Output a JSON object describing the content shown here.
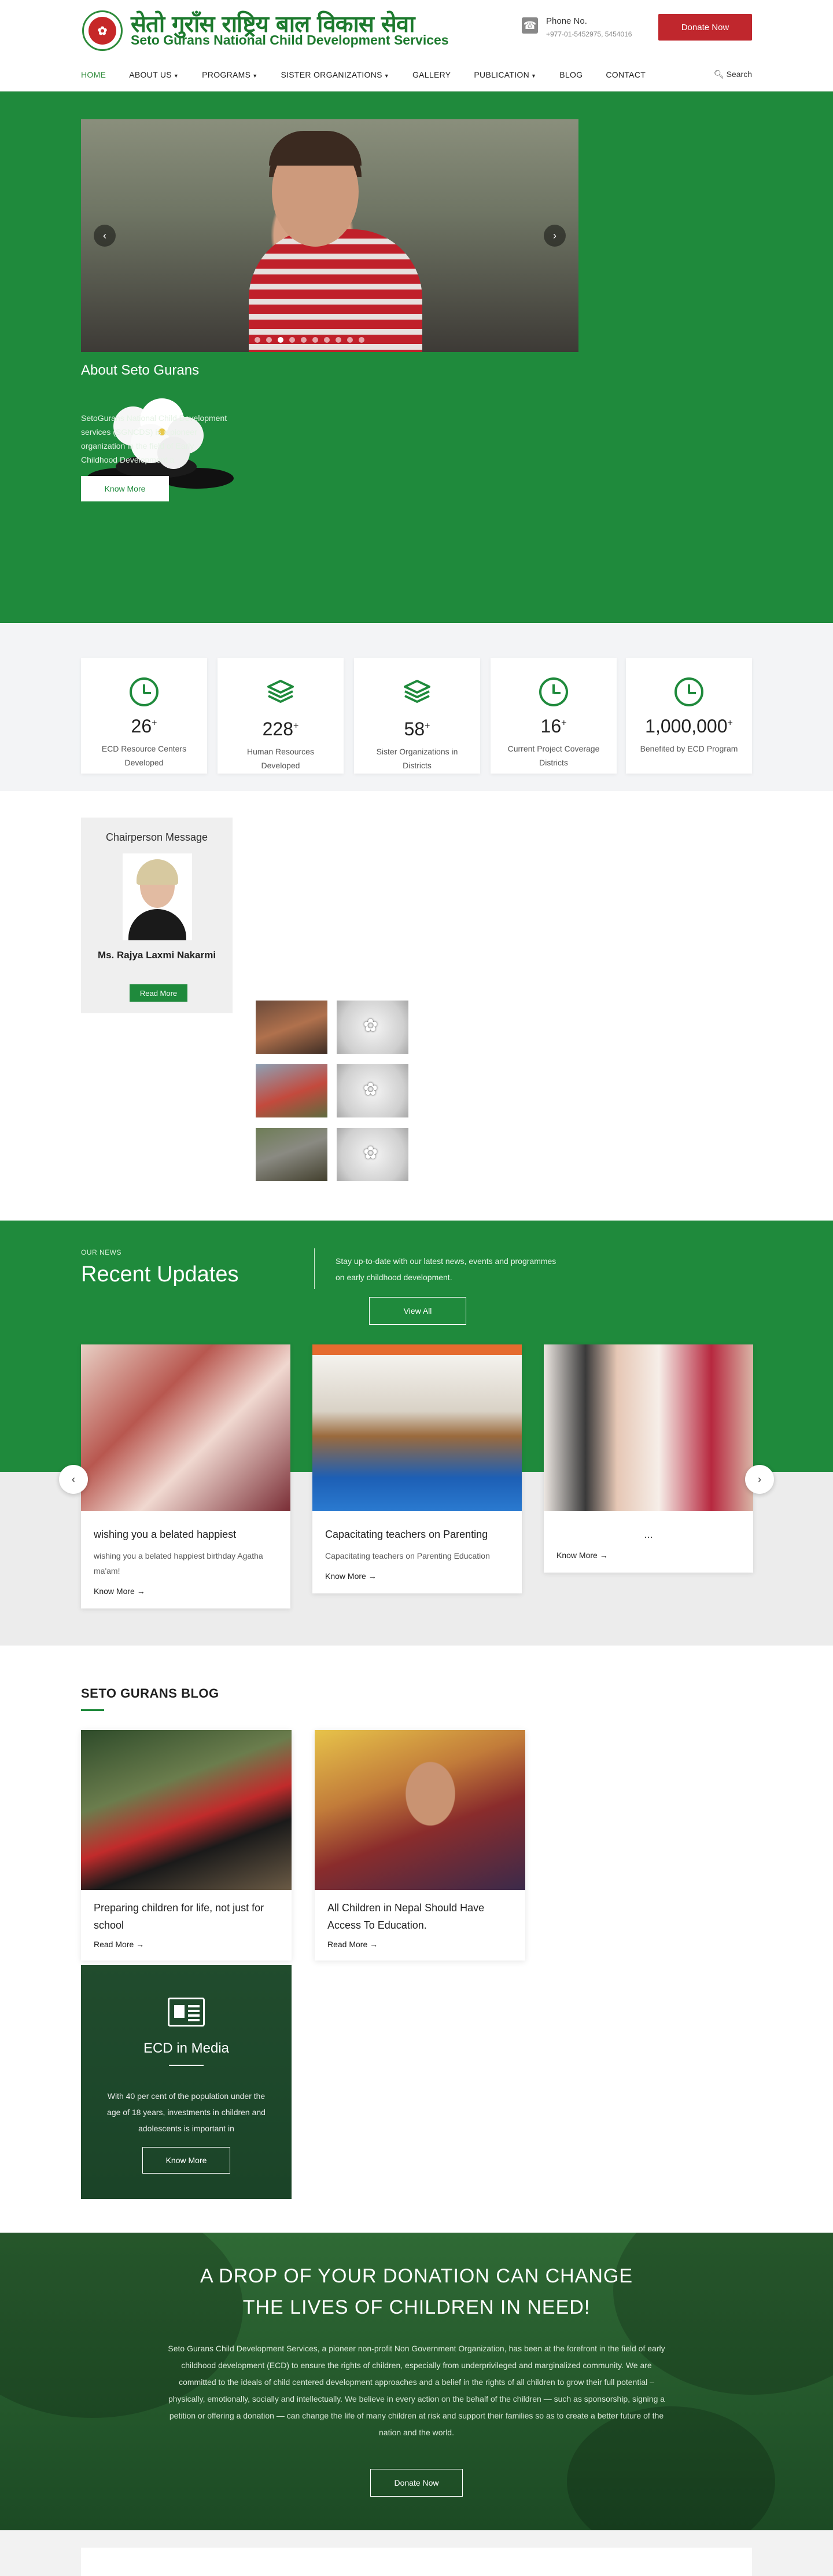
{
  "header": {
    "logo_np": "सेतो गुराँस राष्ट्रिय बाल विकास सेवा",
    "logo_en": "Seto Gurans National Child Development Services",
    "phone_title": "Phone No.",
    "phone_number": "+977-01-5452975, 5454016",
    "donate_label": "Donate Now"
  },
  "nav": {
    "items": [
      {
        "label": "HOME"
      },
      {
        "label": "ABOUT US"
      },
      {
        "label": "PROGRAMS"
      },
      {
        "label": "SISTER ORGANIZATIONS"
      },
      {
        "label": "GALLERY"
      },
      {
        "label": "PUBLICATION"
      },
      {
        "label": "BLOG"
      },
      {
        "label": "CONTACT"
      }
    ],
    "search_label": "Search"
  },
  "about": {
    "title": "About Seto Gurans",
    "text": "SetoGurans National Child Development services (SGNCDS) is a pioneer organization in the field of Early Childhood Development a",
    "button": "Know More"
  },
  "stats": [
    {
      "value": "26",
      "label": "ECD Resource Centers Developed",
      "icon": "clock-icon"
    },
    {
      "value": "228",
      "label": "Human Resources Developed",
      "icon": "layers-icon"
    },
    {
      "value": "58",
      "label": "Sister Organizations in Districts",
      "icon": "layers-icon"
    },
    {
      "value": "16",
      "label": "Current Project Coverage Districts",
      "icon": "clock-icon"
    },
    {
      "value": "1,000,000",
      "label": "Benefited by ECD Program",
      "icon": "clock-icon"
    }
  ],
  "chairperson": {
    "title": "Chairperson Message",
    "name": "Ms. Rajya Laxmi Nakarmi",
    "button": "Read More"
  },
  "news": {
    "small": "OUR NEWS",
    "title": "Recent Updates",
    "desc": "Stay up-to-date with our latest news, events and programmes on early childhood development.",
    "view_all": "View All",
    "cards": [
      {
        "title": "wishing you a belated happiest",
        "text": "wishing you a belated happiest birthday Agatha ma'am!",
        "more": "Know More →"
      },
      {
        "title": "Capacitating teachers on Parenting",
        "text": "Capacitating teachers on Parenting Education",
        "more": "Know More →"
      },
      {
        "title": "...",
        "text": "",
        "more": "Know More →"
      }
    ]
  },
  "blog": {
    "title": "SETO GURANS BLOG",
    "cards": [
      {
        "title": "Preparing children for life, not just for school",
        "more": "Read More →"
      },
      {
        "title": "All Children in Nepal Should Have Access To Education.",
        "more": "Read More →"
      }
    ],
    "media": {
      "title": "ECD in Media",
      "text": "With 40 per cent of the population under the age of 18 years, investments in children and adolescents is important in",
      "button": "Know More"
    }
  },
  "donation": {
    "heading1": "A DROP OF YOUR DONATION CAN CHANGE",
    "heading2": "THE LIVES OF CHILDREN IN NEED!",
    "text": "Seto Gurans Child Development Services, a pioneer non-profit Non Government Organization, has been at the forefront in the field of early childhood development (ECD) to ensure the rights of children, especially from underprivileged and marginalized community. We are committed to the ideals of child centered development approaches and a belief in the rights of all children to grow their full potential – physically, emotionally, socially and intellectually. We believe in every action on the behalf of the children — such as sponsorship, signing a petition or offering a donation — can change the life of many children at risk and support their families so as to create a better future of the nation and the world.",
    "button": "Donate Now"
  },
  "colors": {
    "brand_green": "#1f8a3c",
    "donate_red": "#c0272d"
  }
}
